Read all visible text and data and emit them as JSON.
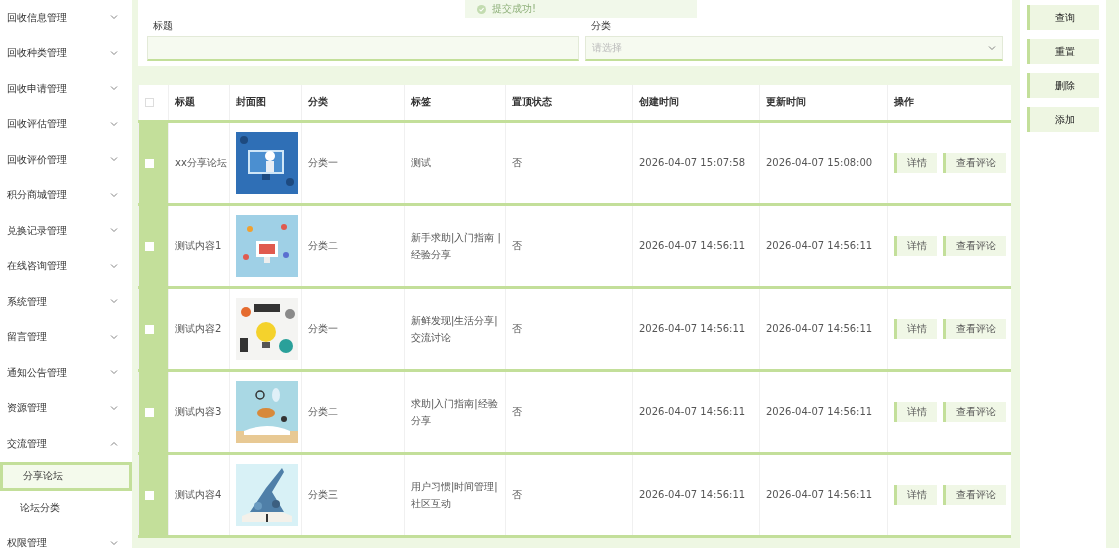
{
  "toast": {
    "message": "提交成功!"
  },
  "sidebar": {
    "items": [
      {
        "label": "回收信息管理",
        "expanded": false
      },
      {
        "label": "回收种类管理",
        "expanded": false
      },
      {
        "label": "回收申请管理",
        "expanded": false
      },
      {
        "label": "回收评估管理",
        "expanded": false
      },
      {
        "label": "回收评价管理",
        "expanded": false
      },
      {
        "label": "积分商城管理",
        "expanded": false
      },
      {
        "label": "兑换记录管理",
        "expanded": false
      },
      {
        "label": "在线咨询管理",
        "expanded": false
      },
      {
        "label": "系统管理",
        "expanded": false
      },
      {
        "label": "留言管理",
        "expanded": false
      },
      {
        "label": "通知公告管理",
        "expanded": false
      },
      {
        "label": "资源管理",
        "expanded": false
      },
      {
        "label": "交流管理",
        "expanded": true,
        "children": [
          {
            "label": "分享论坛",
            "selected": true
          },
          {
            "label": "论坛分类",
            "selected": false
          }
        ]
      },
      {
        "label": "权限管理",
        "expanded": false
      }
    ]
  },
  "search": {
    "title_label": "标题",
    "category_label": "分类",
    "category_placeholder": "请选择"
  },
  "table": {
    "header_checked": false,
    "columns": [
      "标题",
      "封面图",
      "分类",
      "标签",
      "置顶状态",
      "创建时间",
      "更新时间",
      "操作"
    ],
    "rows": [
      {
        "checked": false,
        "title": "xx分享论坛",
        "category": "分类一",
        "tags": "测试",
        "pinned": "否",
        "created": "2026-04-07 15:07:58",
        "updated": "2026-04-07 15:08:00",
        "actions": [
          "详情",
          "查看评论"
        ]
      },
      {
        "checked": false,
        "title": "测试内容1",
        "category": "分类二",
        "tags": "新手求助|入门指南 |经验分享",
        "pinned": "否",
        "created": "2026-04-07 14:56:11",
        "updated": "2026-04-07 14:56:11",
        "actions": [
          "详情",
          "查看评论"
        ]
      },
      {
        "checked": false,
        "title": "测试内容2",
        "category": "分类一",
        "tags": "新鲜发现|生活分享|交流讨论",
        "pinned": "否",
        "created": "2026-04-07 14:56:11",
        "updated": "2026-04-07 14:56:11",
        "actions": [
          "详情",
          "查看评论"
        ]
      },
      {
        "checked": false,
        "title": "测试内容3",
        "category": "分类二",
        "tags": "求助|入门指南|经验分享",
        "pinned": "否",
        "created": "2026-04-07 14:56:11",
        "updated": "2026-04-07 14:56:11",
        "actions": [
          "详情",
          "查看评论"
        ]
      },
      {
        "checked": false,
        "title": "测试内容4",
        "category": "分类三",
        "tags": "用户习惯|时间管理|社区互动",
        "pinned": "否",
        "created": "2026-04-07 14:56:11",
        "updated": "2026-04-07 14:56:11",
        "actions": [
          "详情",
          "查看评论"
        ]
      }
    ]
  },
  "toolbar": {
    "buttons": [
      "查询",
      "重置",
      "删除",
      "添加"
    ]
  }
}
